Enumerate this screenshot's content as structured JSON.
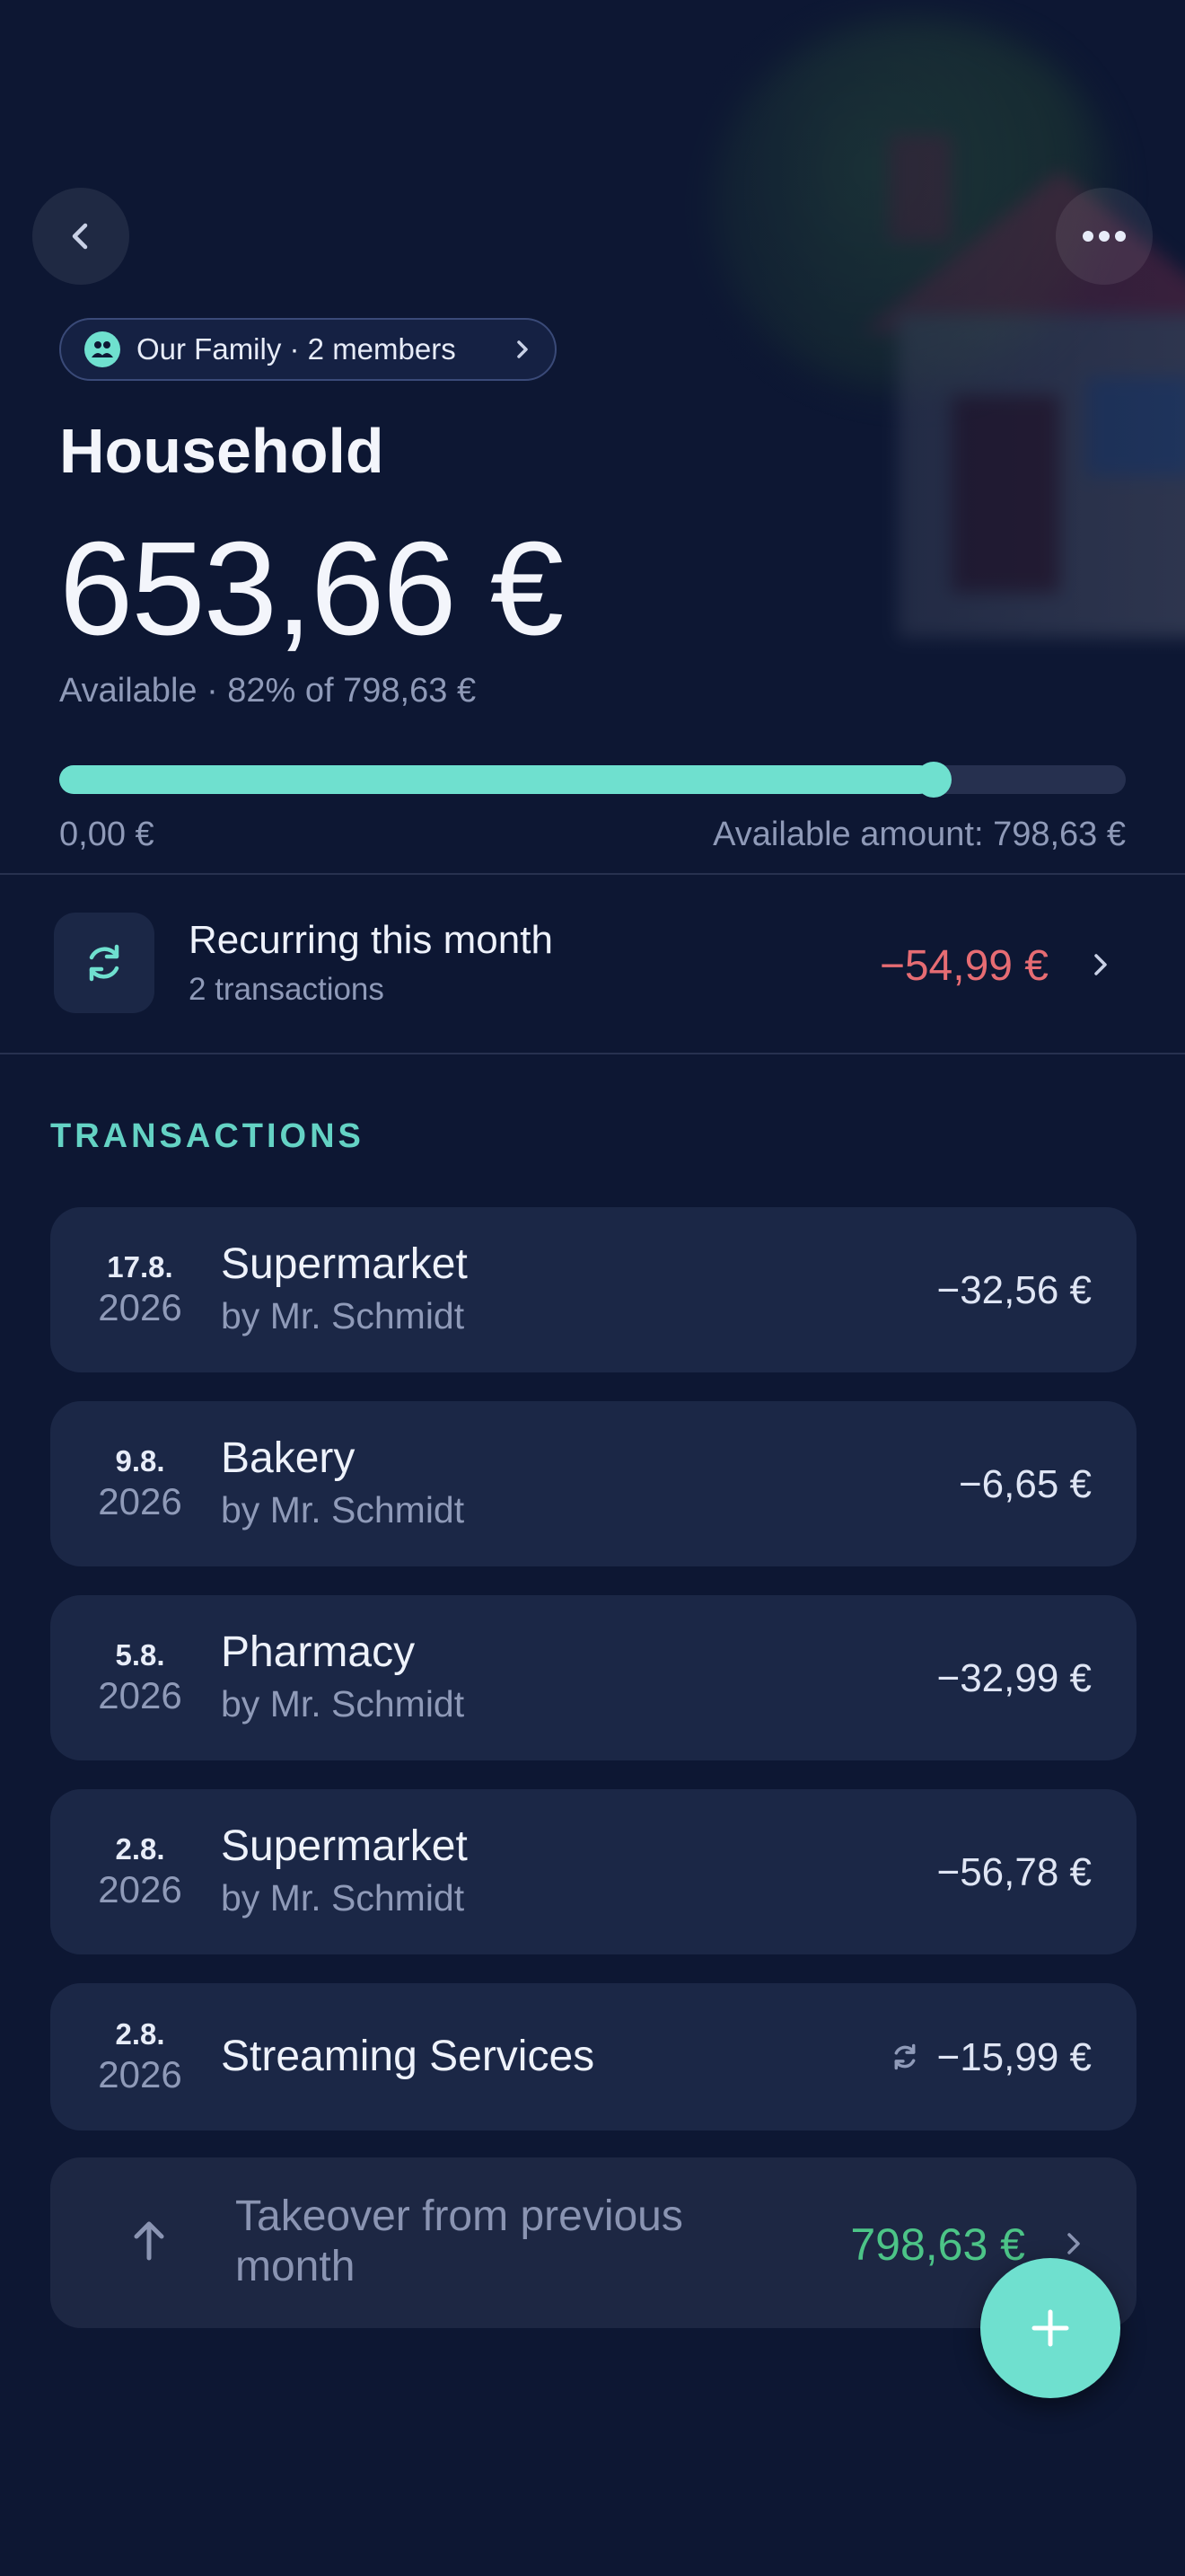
{
  "header": {
    "group_chip": "Our Family · 2 members",
    "title": "Household",
    "available_amount": "653,66 €",
    "available_caption": "Available · 82% of 798,63 €",
    "progress_fraction": 0.82,
    "range_min": "0,00 €",
    "range_max": "Available amount: 798,63 €"
  },
  "recurring": {
    "title": "Recurring this month",
    "subtitle": "2 transactions",
    "amount": "−54,99 €"
  },
  "transactions_label": "TRANSACTIONS",
  "transactions": [
    {
      "day": "17.8.",
      "year": "2026",
      "name": "Supermarket",
      "by": "by Mr. Schmidt",
      "amount": "−32,56 €"
    },
    {
      "day": "9.8.",
      "year": "2026",
      "name": "Bakery",
      "by": "by Mr. Schmidt",
      "amount": "−6,65 €"
    },
    {
      "day": "5.8.",
      "year": "2026",
      "name": "Pharmacy",
      "by": "by Mr. Schmidt",
      "amount": "−32,99 €"
    },
    {
      "day": "2.8.",
      "year": "2026",
      "name": "Supermarket",
      "by": "by Mr. Schmidt",
      "amount": "−56,78 €"
    },
    {
      "day": "2.8.",
      "year": "2026",
      "name": "Streaming Services",
      "amount": "−15,99 €",
      "recurring": true
    }
  ],
  "takeover": {
    "label": "Takeover from previous month",
    "amount": "798,63 €"
  },
  "colors": {
    "background": "#0d1733",
    "card": "#1b2746",
    "accent": "#6fe0cf",
    "negative": "#e66c73",
    "positive": "#4cc487"
  },
  "icons": {
    "back": "back-arrow-icon",
    "more": "more-dots-icon",
    "group": "group-people-icon",
    "recurring": "refresh-icon",
    "add": "plus-icon"
  }
}
